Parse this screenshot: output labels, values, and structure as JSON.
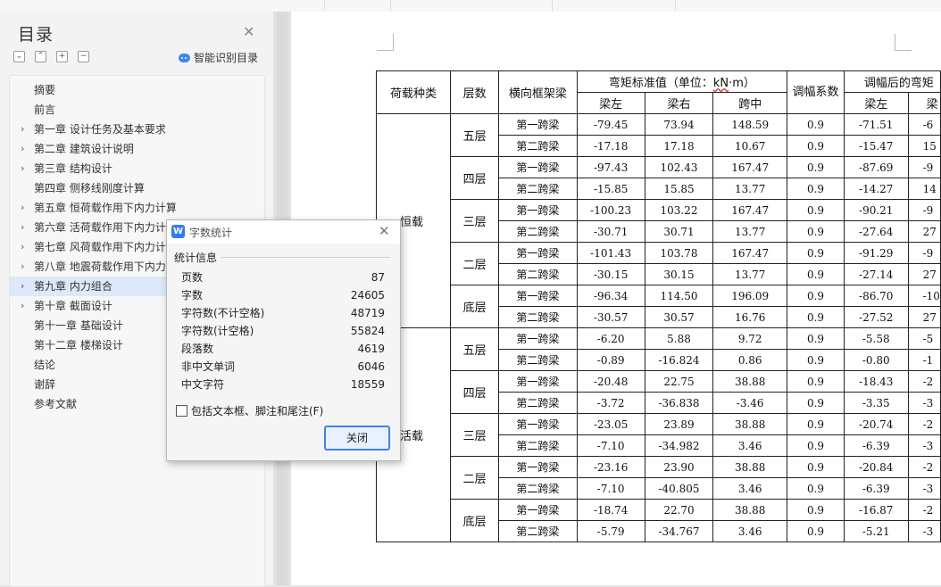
{
  "toc": {
    "title": "目录",
    "smart_label": "智能识别目录",
    "items": [
      {
        "label": "摘要",
        "arrow": ""
      },
      {
        "label": "前言",
        "arrow": ""
      },
      {
        "label": "第一章  设计任务及基本要求",
        "arrow": "›"
      },
      {
        "label": "第二章  建筑设计说明",
        "arrow": "›"
      },
      {
        "label": "第三章  结构设计",
        "arrow": "›"
      },
      {
        "label": "第四章  侧移线刚度计算",
        "arrow": ""
      },
      {
        "label": "第五章  恒荷载作用下内力计算",
        "arrow": "›"
      },
      {
        "label": "第六章  活荷载作用下内力计算",
        "arrow": "›"
      },
      {
        "label": "第七章  风荷载作用下内力计算",
        "arrow": "›"
      },
      {
        "label": "第八章  地震荷载作用下内力计算",
        "arrow": "›"
      },
      {
        "label": "第九章  内力组合",
        "arrow": "›"
      },
      {
        "label": "第十章  截面设计",
        "arrow": "›"
      },
      {
        "label": "第十一章  基础设计",
        "arrow": ""
      },
      {
        "label": "第十二章  楼梯设计",
        "arrow": ""
      },
      {
        "label": "结论",
        "arrow": ""
      },
      {
        "label": "谢辞",
        "arrow": ""
      },
      {
        "label": "参考文献",
        "arrow": ""
      }
    ]
  },
  "table": {
    "headers": {
      "load_type": "荷载种类",
      "floor": "层数",
      "beam": "横向框架梁",
      "moment_prefix": "弯矩标准值（单位：",
      "moment_unit": "kN",
      "moment_suffix": "·m）",
      "adj": "调幅系数",
      "after": "调幅后的弯矩",
      "left": "梁左",
      "right": "梁右",
      "mid": "跨中",
      "after_left": "梁左",
      "after_right": "梁"
    },
    "groups": [
      {
        "load": "恒载",
        "floors": [
          {
            "floor": "五层",
            "rows": [
              {
                "beam": "第一跨梁",
                "left": "-79.45",
                "right": "73.94",
                "mid": "148.59",
                "adj": "0.9",
                "aleft": "-71.51",
                "aright": "-6"
              },
              {
                "beam": "第二跨梁",
                "left": "-17.18",
                "right": "17.18",
                "mid": "10.67",
                "adj": "0.9",
                "aleft": "-15.47",
                "aright": "15"
              }
            ]
          },
          {
            "floor": "四层",
            "rows": [
              {
                "beam": "第一跨梁",
                "left": "-97.43",
                "right": "102.43",
                "mid": "167.47",
                "adj": "0.9",
                "aleft": "-87.69",
                "aright": "-9"
              },
              {
                "beam": "第二跨梁",
                "left": "-15.85",
                "right": "15.85",
                "mid": "13.77",
                "adj": "0.9",
                "aleft": "-14.27",
                "aright": "14"
              }
            ]
          },
          {
            "floor": "三层",
            "rows": [
              {
                "beam": "第一跨梁",
                "left": "-100.23",
                "right": "103.22",
                "mid": "167.47",
                "adj": "0.9",
                "aleft": "-90.21",
                "aright": "-9"
              },
              {
                "beam": "第二跨梁",
                "left": "-30.71",
                "right": "30.71",
                "mid": "13.77",
                "adj": "0.9",
                "aleft": "-27.64",
                "aright": "27"
              }
            ]
          },
          {
            "floor": "二层",
            "rows": [
              {
                "beam": "第一跨梁",
                "left": "-101.43",
                "right": "103.78",
                "mid": "167.47",
                "adj": "0.9",
                "aleft": "-91.29",
                "aright": "-9"
              },
              {
                "beam": "第二跨梁",
                "left": "-30.15",
                "right": "30.15",
                "mid": "13.77",
                "adj": "0.9",
                "aleft": "-27.14",
                "aright": "27"
              }
            ]
          },
          {
            "floor": "底层",
            "rows": [
              {
                "beam": "第一跨梁",
                "left": "-96.34",
                "right": "114.50",
                "mid": "196.09",
                "adj": "0.9",
                "aleft": "-86.70",
                "aright": "-10"
              },
              {
                "beam": "第二跨梁",
                "left": "-30.57",
                "right": "30.57",
                "mid": "16.76",
                "adj": "0.9",
                "aleft": "-27.52",
                "aright": "27"
              }
            ]
          }
        ]
      },
      {
        "load": "活载",
        "floors": [
          {
            "floor": "五层",
            "rows": [
              {
                "beam": "第一跨梁",
                "left": "-6.20",
                "right": "5.88",
                "mid": "9.72",
                "adj": "0.9",
                "aleft": "-5.58",
                "aright": "-5"
              },
              {
                "beam": "第二跨梁",
                "left": "-0.89",
                "right": "-16.824",
                "mid": "0.86",
                "adj": "0.9",
                "aleft": "-0.80",
                "aright": "-1"
              }
            ]
          },
          {
            "floor": "四层",
            "rows": [
              {
                "beam": "第一跨梁",
                "left": "-20.48",
                "right": "22.75",
                "mid": "38.88",
                "adj": "0.9",
                "aleft": "-18.43",
                "aright": "-2"
              },
              {
                "beam": "第二跨梁",
                "left": "-3.72",
                "right": "-36.838",
                "mid": "-3.46",
                "adj": "0.9",
                "aleft": "-3.35",
                "aright": "-3"
              }
            ]
          },
          {
            "floor": "三层",
            "rows": [
              {
                "beam": "第一跨梁",
                "left": "-23.05",
                "right": "23.89",
                "mid": "38.88",
                "adj": "0.9",
                "aleft": "-20.74",
                "aright": "-2"
              },
              {
                "beam": "第二跨梁",
                "left": "-7.10",
                "right": "-34.982",
                "mid": "3.46",
                "adj": "0.9",
                "aleft": "-6.39",
                "aright": "-3"
              }
            ]
          },
          {
            "floor": "二层",
            "rows": [
              {
                "beam": "第一跨梁",
                "left": "-23.16",
                "right": "23.90",
                "mid": "38.88",
                "adj": "0.9",
                "aleft": "-20.84",
                "aright": "-2"
              },
              {
                "beam": "第二跨梁",
                "left": "-7.10",
                "right": "-40.805",
                "mid": "3.46",
                "adj": "0.9",
                "aleft": "-6.39",
                "aright": "-3"
              }
            ]
          },
          {
            "floor": "底层",
            "rows": [
              {
                "beam": "第一跨梁",
                "left": "-18.74",
                "right": "22.70",
                "mid": "38.88",
                "adj": "0.9",
                "aleft": "-16.87",
                "aright": "-2"
              },
              {
                "beam": "第二跨梁",
                "left": "-5.79",
                "right": "-34.767",
                "mid": "3.46",
                "adj": "0.9",
                "aleft": "-5.21",
                "aright": "-3"
              }
            ]
          }
        ]
      }
    ]
  },
  "dialog": {
    "title": "字数统计",
    "section": "统计信息",
    "stats": [
      {
        "label": "页数",
        "value": "87"
      },
      {
        "label": "字数",
        "value": "24605"
      },
      {
        "label": "字符数(不计空格)",
        "value": "48719"
      },
      {
        "label": "字符数(计空格)",
        "value": "55824"
      },
      {
        "label": "段落数",
        "value": "4619"
      },
      {
        "label": "非中文单词",
        "value": "6046"
      },
      {
        "label": "中文字符",
        "value": "18559"
      }
    ],
    "checkbox_label": "包括文本框、脚注和尾注(F)",
    "checkbox_checked": false,
    "close_label": "关闭"
  },
  "colors": {
    "accent": "#2f7cf6",
    "selected": "#dde8f9"
  }
}
